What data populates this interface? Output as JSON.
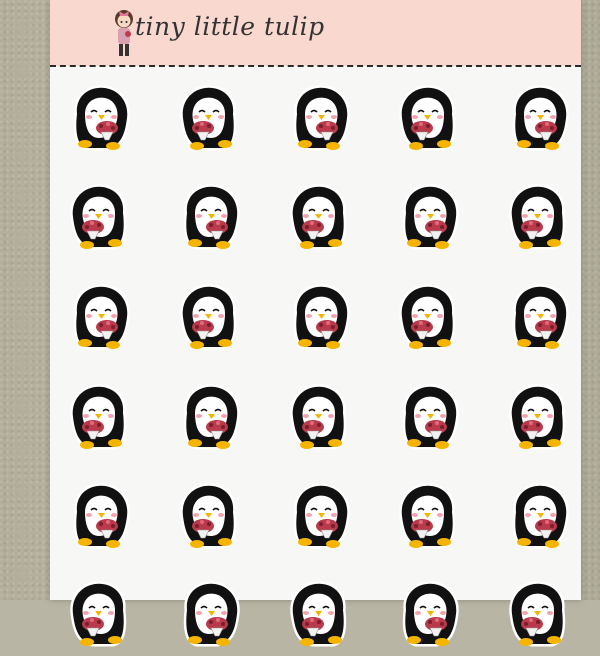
{
  "header": {
    "brand": "tiny little tulip",
    "background": "#f9d9cf"
  },
  "sheet": {
    "background": "#f7f7f6",
    "sticker_rows": 6,
    "sticker_columns": 5,
    "sticker_subject": "penguin-holding-flower-bouquet-icon"
  },
  "colors": {
    "penguin_body": "#111111",
    "penguin_face": "#ffffff",
    "beak_feet": "#f4b400",
    "bouquet": "#b83a4b",
    "cheek": "#f3a3b0"
  }
}
